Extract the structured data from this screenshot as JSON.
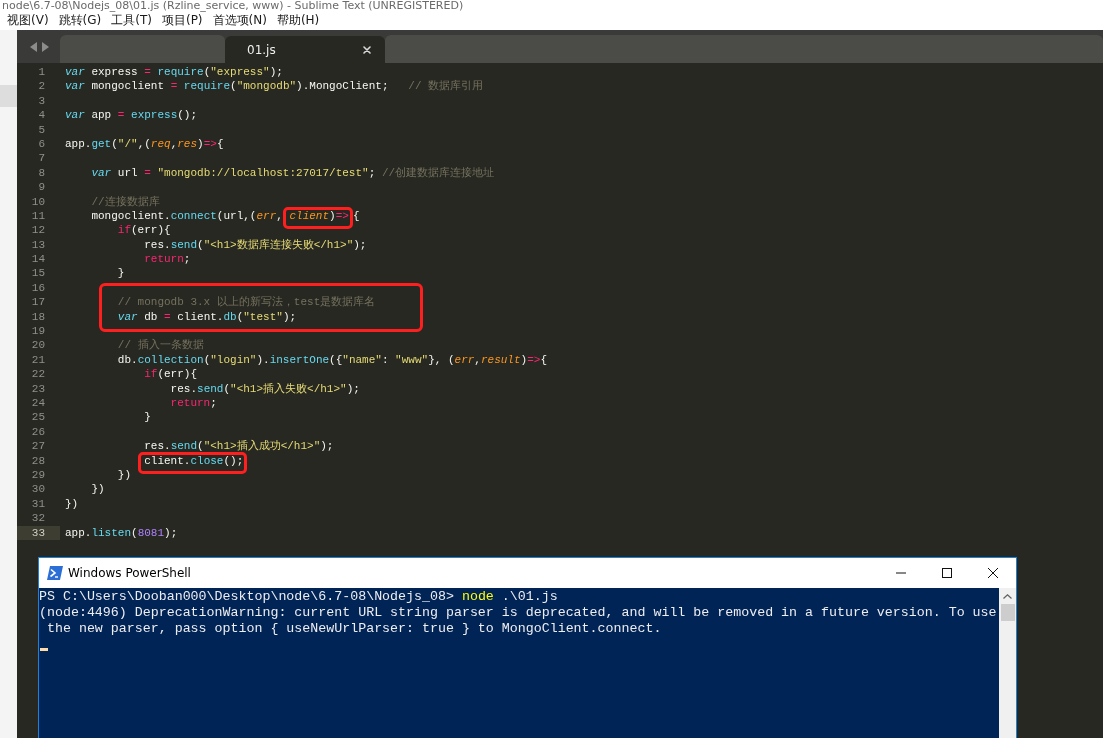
{
  "window": {
    "title": "node\\6.7-08\\Nodejs_08\\01.js (Rzline_service, www) - Sublime Text (UNREGISTERED)"
  },
  "menu": [
    "视图(V)",
    "跳转(G)",
    "工具(T)",
    "项目(P)",
    "首选项(N)",
    "帮助(H)"
  ],
  "tabs": [
    {
      "label": "01.js",
      "selected": true
    }
  ],
  "code": {
    "lines": [
      {
        "kind": "line",
        "number": "1",
        "current": false,
        "tokens": [
          {
            "kind": "storage",
            "text": "var"
          },
          {
            "kind": "text",
            "text": " express "
          },
          {
            "kind": "op",
            "text": "= "
          },
          {
            "kind": "support",
            "text": "require"
          },
          {
            "kind": "text",
            "text": "("
          },
          {
            "kind": "string",
            "text": "\"express\""
          },
          {
            "kind": "text",
            "text": ");"
          }
        ]
      },
      {
        "kind": "line",
        "number": "2",
        "current": false,
        "tokens": [
          {
            "kind": "storage",
            "text": "var"
          },
          {
            "kind": "text",
            "text": " mongoclient "
          },
          {
            "kind": "op",
            "text": "= "
          },
          {
            "kind": "support",
            "text": "require"
          },
          {
            "kind": "text",
            "text": "("
          },
          {
            "kind": "string",
            "text": "\"mongodb\""
          },
          {
            "kind": "text",
            "text": ").MongoClient;   "
          },
          {
            "kind": "comment",
            "text": "// 数据库引用"
          }
        ]
      },
      {
        "kind": "line",
        "number": "3",
        "current": false
      },
      {
        "kind": "line",
        "number": "4",
        "current": false,
        "tokens": [
          {
            "kind": "storage",
            "text": "var"
          },
          {
            "kind": "text",
            "text": " app "
          },
          {
            "kind": "op",
            "text": "= "
          },
          {
            "kind": "method",
            "text": "express"
          },
          {
            "kind": "text",
            "text": "();"
          }
        ]
      },
      {
        "kind": "line",
        "number": "5",
        "current": false
      },
      {
        "kind": "line",
        "number": "6",
        "current": false,
        "tokens": [
          {
            "kind": "text",
            "text": "app."
          },
          {
            "kind": "method",
            "text": "get"
          },
          {
            "kind": "text",
            "text": "("
          },
          {
            "kind": "string",
            "text": "\"/\""
          },
          {
            "kind": "text",
            "text": ",("
          },
          {
            "kind": "param",
            "text": "req"
          },
          {
            "kind": "text",
            "text": ","
          },
          {
            "kind": "param",
            "text": "res"
          },
          {
            "kind": "text",
            "text": ")"
          },
          {
            "kind": "op",
            "text": "=>"
          },
          {
            "kind": "text",
            "text": "{"
          }
        ]
      },
      {
        "kind": "line",
        "number": "7",
        "current": false
      },
      {
        "kind": "line",
        "number": "8",
        "current": false,
        "tokens": [
          {
            "kind": "storage",
            "text": "    var"
          },
          {
            "kind": "text",
            "text": " url "
          },
          {
            "kind": "op",
            "text": "= "
          },
          {
            "kind": "string",
            "text": "\"mongodb://localhost:27017/test\""
          },
          {
            "kind": "text",
            "text": "; "
          },
          {
            "kind": "comment",
            "text": "//创建数据库连接地址"
          }
        ]
      },
      {
        "kind": "line",
        "number": "9",
        "current": false
      },
      {
        "kind": "line",
        "number": "10",
        "current": false,
        "tokens": [
          {
            "kind": "comment",
            "text": "    //连接数据库"
          }
        ]
      },
      {
        "kind": "line",
        "number": "11",
        "current": false,
        "tokens": [
          {
            "kind": "text",
            "text": "    mongoclient."
          },
          {
            "kind": "method",
            "text": "connect"
          },
          {
            "kind": "text",
            "text": "(url,("
          },
          {
            "kind": "param",
            "text": "err"
          },
          {
            "kind": "text",
            "text": ", "
          },
          {
            "kind": "frame",
            "tokens": [
              {
                "kind": "param",
                "text": "client"
              },
              {
                "kind": "text",
                "text": ")"
              },
              {
                "kind": "op",
                "text": "=>"
              }
            ]
          },
          {
            "kind": "text",
            "text": "{"
          }
        ]
      },
      {
        "kind": "line",
        "number": "12",
        "current": false,
        "tokens": [
          {
            "kind": "keyword",
            "text": "        if"
          },
          {
            "kind": "text",
            "text": "(err){"
          }
        ]
      },
      {
        "kind": "line",
        "number": "13",
        "current": false,
        "tokens": [
          {
            "kind": "text",
            "text": "            res."
          },
          {
            "kind": "method",
            "text": "send"
          },
          {
            "kind": "text",
            "text": "("
          },
          {
            "kind": "string",
            "text": "\"<h1>数据库连接失败</h1>\""
          },
          {
            "kind": "text",
            "text": ");"
          }
        ]
      },
      {
        "kind": "line",
        "number": "14",
        "current": false,
        "tokens": [
          {
            "kind": "keyword",
            "text": "            return"
          },
          {
            "kind": "text",
            "text": ";"
          }
        ]
      },
      {
        "kind": "line",
        "number": "15",
        "current": false,
        "tokens": [
          {
            "kind": "text",
            "text": "        }"
          }
        ]
      },
      {
        "kind": "line",
        "number": "16",
        "current": false
      },
      {
        "kind": "frame",
        "lines": [
          {
            "number": "17",
            "current": false,
            "tokens": [
              {
                "kind": "comment",
                "text": "        // mongodb 3.x 以上的新写法，test是数据库名"
              }
            ]
          },
          {
            "number": "18",
            "current": false,
            "tokens": [
              {
                "kind": "storage",
                "text": "        var"
              },
              {
                "kind": "text",
                "text": " db "
              },
              {
                "kind": "op",
                "text": "= "
              },
              {
                "kind": "text",
                "text": "client."
              },
              {
                "kind": "method",
                "text": "db"
              },
              {
                "kind": "text",
                "text": "("
              },
              {
                "kind": "string",
                "text": "\"test\""
              },
              {
                "kind": "text",
                "text": ");"
              }
            ]
          }
        ]
      },
      {
        "kind": "line",
        "number": "19",
        "current": false
      },
      {
        "kind": "line",
        "number": "20",
        "current": false,
        "tokens": [
          {
            "kind": "comment",
            "text": "        // 插入一条数据"
          }
        ]
      },
      {
        "kind": "line",
        "number": "21",
        "current": false,
        "tokens": [
          {
            "kind": "text",
            "text": "        db."
          },
          {
            "kind": "method",
            "text": "collection"
          },
          {
            "kind": "text",
            "text": "("
          },
          {
            "kind": "string",
            "text": "\"login\""
          },
          {
            "kind": "text",
            "text": ")."
          },
          {
            "kind": "method",
            "text": "insertOne"
          },
          {
            "kind": "text",
            "text": "({"
          },
          {
            "kind": "string",
            "text": "\"name\""
          },
          {
            "kind": "text",
            "text": ": "
          },
          {
            "kind": "string",
            "text": "\"www\""
          },
          {
            "kind": "text",
            "text": "}, ("
          },
          {
            "kind": "param",
            "text": "err"
          },
          {
            "kind": "text",
            "text": ","
          },
          {
            "kind": "param",
            "text": "result"
          },
          {
            "kind": "text",
            "text": ")"
          },
          {
            "kind": "op",
            "text": "=>"
          },
          {
            "kind": "text",
            "text": "{"
          }
        ]
      },
      {
        "kind": "line",
        "number": "22",
        "current": false,
        "tokens": [
          {
            "kind": "keyword",
            "text": "            if"
          },
          {
            "kind": "text",
            "text": "(err){"
          }
        ]
      },
      {
        "kind": "line",
        "number": "23",
        "current": false,
        "tokens": [
          {
            "kind": "text",
            "text": "                res."
          },
          {
            "kind": "method",
            "text": "send"
          },
          {
            "kind": "text",
            "text": "("
          },
          {
            "kind": "string",
            "text": "\"<h1>插入失败</h1>\""
          },
          {
            "kind": "text",
            "text": ");"
          }
        ]
      },
      {
        "kind": "line",
        "number": "24",
        "current": false,
        "tokens": [
          {
            "kind": "keyword",
            "text": "                return"
          },
          {
            "kind": "text",
            "text": ";"
          }
        ]
      },
      {
        "kind": "line",
        "number": "25",
        "current": false,
        "tokens": [
          {
            "kind": "text",
            "text": "            }"
          }
        ]
      },
      {
        "kind": "line",
        "number": "26",
        "current": false
      },
      {
        "kind": "line",
        "number": "27",
        "current": false,
        "tokens": [
          {
            "kind": "text",
            "text": "            res."
          },
          {
            "kind": "method",
            "text": "send"
          },
          {
            "kind": "text",
            "text": "("
          },
          {
            "kind": "string",
            "text": "\"<h1>插入成功</h1>\""
          },
          {
            "kind": "text",
            "text": ");"
          }
        ]
      },
      {
        "kind": "line",
        "number": "28",
        "current": false,
        "tokens": [
          {
            "kind": "frame",
            "tokens": [
              {
                "kind": "text",
                "text": "            client."
              },
              {
                "kind": "method",
                "text": "close"
              },
              {
                "kind": "text",
                "text": "();"
              }
            ]
          }
        ]
      },
      {
        "kind": "line",
        "number": "29",
        "current": false,
        "tokens": [
          {
            "kind": "text",
            "text": "        })"
          }
        ]
      },
      {
        "kind": "line",
        "number": "30",
        "current": false,
        "tokens": [
          {
            "kind": "text",
            "text": "    })"
          }
        ]
      },
      {
        "kind": "line",
        "number": "31",
        "current": false,
        "tokens": [
          {
            "kind": "text",
            "text": "})"
          }
        ]
      },
      {
        "kind": "line",
        "number": "32",
        "current": false
      },
      {
        "kind": "line",
        "number": "33",
        "current": true,
        "tokens": [
          {
            "kind": "text",
            "text": "app."
          },
          {
            "kind": "method",
            "text": "listen"
          },
          {
            "kind": "text",
            "text": "("
          },
          {
            "kind": "number",
            "text": "8081"
          },
          {
            "kind": "text",
            "text": ");"
          }
        ]
      }
    ]
  },
  "terminal": {
    "title": "Windows PowerShell",
    "lines": [
      {
        "segments": [
          {
            "kind": "prompt",
            "text": "PS C:\\Users\\Dooban000\\Desktop\\node\\6.7-08\\Nodejs_08> "
          },
          {
            "kind": "command",
            "text": "node"
          },
          {
            "kind": "output",
            "text": " .\\01.js"
          }
        ]
      },
      {
        "segments": [
          {
            "kind": "output",
            "text": "(node:4496) DeprecationWarning: current URL string parser is deprecated, and will be removed in a future version. To use"
          }
        ]
      },
      {
        "segments": [
          {
            "kind": "output",
            "text": " the new parser, pass option { useNewUrlParser: true } to MongoClient.connect."
          }
        ]
      }
    ],
    "cursor": true
  }
}
